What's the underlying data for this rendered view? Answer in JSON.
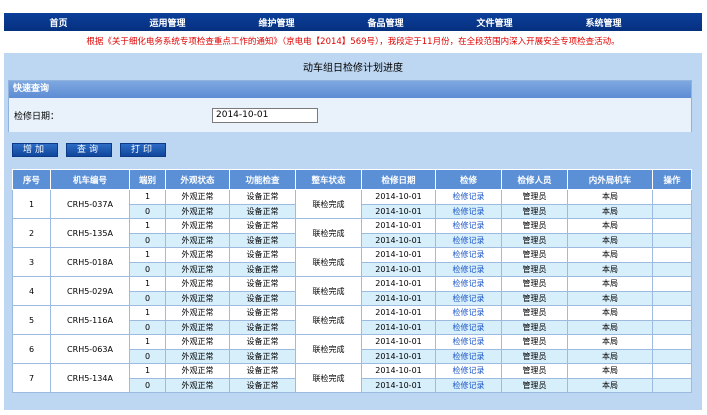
{
  "nav": {
    "items": [
      "首页",
      "运用管理",
      "维护管理",
      "备品管理",
      "文件管理",
      "系统管理"
    ]
  },
  "notice": "根据《关于细化电务系统专项检查重点工作的通知》（京电电【2014】569号），我段定于11月份，在全段范围内深入开展安全专项检查活动。",
  "page_title": "动车组日检修计划进度",
  "query": {
    "header": "快速查询",
    "date_label": "检修日期：",
    "date_value": "2014-10-01"
  },
  "buttons": {
    "add": "增加",
    "query": "查询",
    "print": "打印"
  },
  "table": {
    "headers": [
      "序号",
      "机车编号",
      "端别",
      "外观状态",
      "功能检查",
      "整车状态",
      "检修日期",
      "检修",
      "检修人员",
      "内外局机车",
      "操作"
    ],
    "groups": [
      {
        "seq": "1",
        "car": "CRH5-037A",
        "overall": "联检完成",
        "rows": [
          {
            "end": "1",
            "appearance": "外观正常",
            "function": "设备正常",
            "date": "2014-10-01",
            "record": "检修记录",
            "staff": "管理员",
            "bureau": "本局"
          },
          {
            "end": "0",
            "appearance": "外观正常",
            "function": "设备正常",
            "date": "2014-10-01",
            "record": "检修记录",
            "staff": "管理员",
            "bureau": "本局"
          }
        ]
      },
      {
        "seq": "2",
        "car": "CRH5-135A",
        "overall": "联检完成",
        "rows": [
          {
            "end": "1",
            "appearance": "外观正常",
            "function": "设备正常",
            "date": "2014-10-01",
            "record": "检修记录",
            "staff": "管理员",
            "bureau": "本局"
          },
          {
            "end": "0",
            "appearance": "外观正常",
            "function": "设备正常",
            "date": "2014-10-01",
            "record": "检修记录",
            "staff": "管理员",
            "bureau": "本局"
          }
        ]
      },
      {
        "seq": "3",
        "car": "CRH5-018A",
        "overall": "联检完成",
        "rows": [
          {
            "end": "1",
            "appearance": "外观正常",
            "function": "设备正常",
            "date": "2014-10-01",
            "record": "检修记录",
            "staff": "管理员",
            "bureau": "本局"
          },
          {
            "end": "0",
            "appearance": "外观正常",
            "function": "设备正常",
            "date": "2014-10-01",
            "record": "检修记录",
            "staff": "管理员",
            "bureau": "本局"
          }
        ]
      },
      {
        "seq": "4",
        "car": "CRH5-029A",
        "overall": "联检完成",
        "rows": [
          {
            "end": "1",
            "appearance": "外观正常",
            "function": "设备正常",
            "date": "2014-10-01",
            "record": "检修记录",
            "staff": "管理员",
            "bureau": "本局"
          },
          {
            "end": "0",
            "appearance": "外观正常",
            "function": "设备正常",
            "date": "2014-10-01",
            "record": "检修记录",
            "staff": "管理员",
            "bureau": "本局"
          }
        ]
      },
      {
        "seq": "5",
        "car": "CRH5-116A",
        "overall": "联检完成",
        "rows": [
          {
            "end": "1",
            "appearance": "外观正常",
            "function": "设备正常",
            "date": "2014-10-01",
            "record": "检修记录",
            "staff": "管理员",
            "bureau": "本局"
          },
          {
            "end": "0",
            "appearance": "外观正常",
            "function": "设备正常",
            "date": "2014-10-01",
            "record": "检修记录",
            "staff": "管理员",
            "bureau": "本局"
          }
        ]
      },
      {
        "seq": "6",
        "car": "CRH5-063A",
        "overall": "联检完成",
        "rows": [
          {
            "end": "1",
            "appearance": "外观正常",
            "function": "设备正常",
            "date": "2014-10-01",
            "record": "检修记录",
            "staff": "管理员",
            "bureau": "本局"
          },
          {
            "end": "0",
            "appearance": "外观正常",
            "function": "设备正常",
            "date": "2014-10-01",
            "record": "检修记录",
            "staff": "管理员",
            "bureau": "本局"
          }
        ]
      },
      {
        "seq": "7",
        "car": "CRH5-134A",
        "overall": "联检完成",
        "rows": [
          {
            "end": "1",
            "appearance": "外观正常",
            "function": "设备正常",
            "date": "2014-10-01",
            "record": "检修记录",
            "staff": "管理员",
            "bureau": "本局"
          },
          {
            "end": "0",
            "appearance": "外观正常",
            "function": "设备正常",
            "date": "2014-10-01",
            "record": "检修记录",
            "staff": "管理员",
            "bureau": "本局"
          }
        ]
      }
    ]
  },
  "colors": {
    "nav_bg": "#0b3f9a",
    "notice_text": "#e00000",
    "content_bg": "#bdd6f1",
    "table_header": "#5b8fd6",
    "link": "#1a55c7"
  }
}
